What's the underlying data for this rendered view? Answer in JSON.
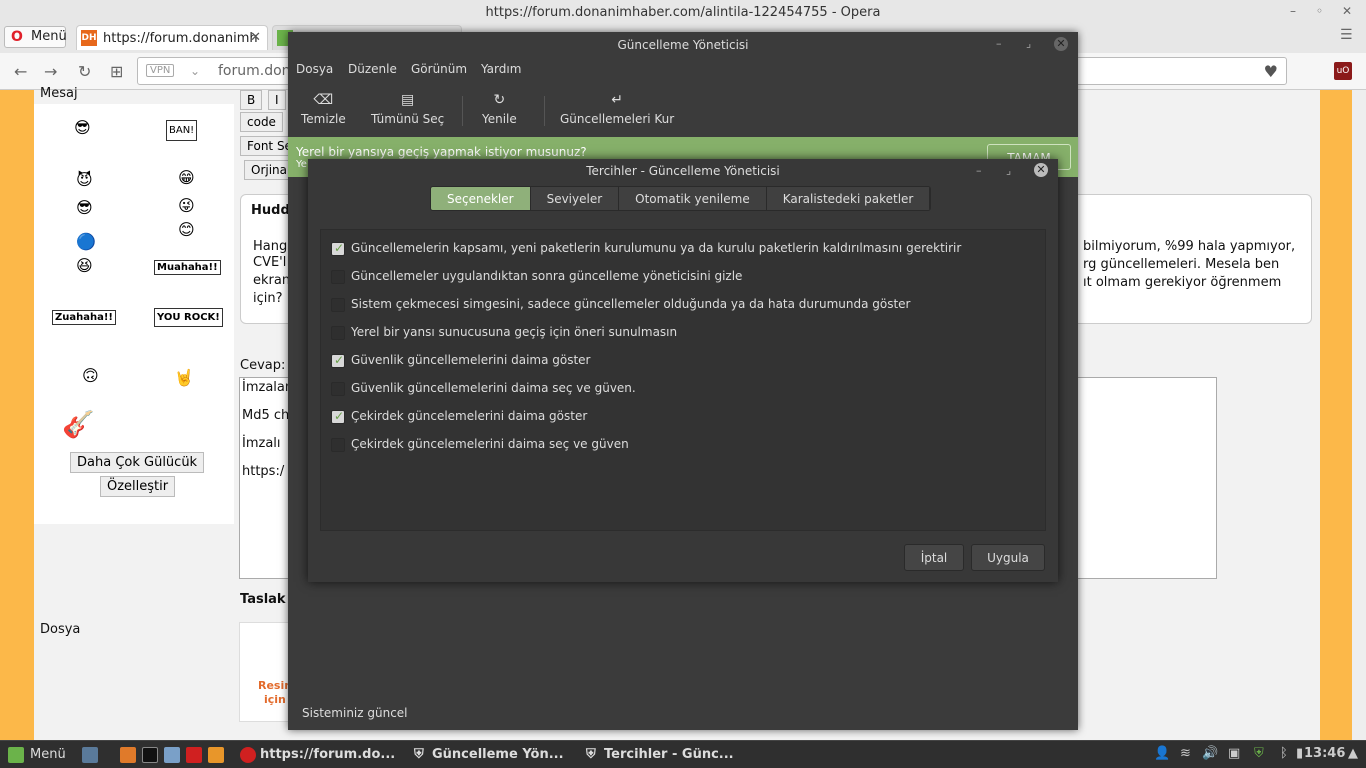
{
  "opera": {
    "window_title": "https://forum.donanimhaber.com/alintila-122454755 - Opera",
    "menu_label": "Menü",
    "tab1_label": "https://forum.donanimh",
    "tab1_icon": "DH",
    "vpn_label": "VPN",
    "url_text": "forum.dona"
  },
  "forum": {
    "mesaj_label": "Mesaj",
    "ban_sign": "BAN!",
    "muahaha_sign": "Muahaha!!",
    "zuahaha_sign": "Zuahaha!!",
    "rock_sign": "ROCK!",
    "you_sign": "YOU",
    "more_smileys": "Daha Çok Gülücük",
    "customize": "Özelleştir",
    "toolbar_bold": "B",
    "toolbar_italic": "I",
    "toolbar_code": "code",
    "font_select": "Font Se",
    "orijinal": "Orjinal",
    "quote_author": "Hudd",
    "quote_line1": "Hang",
    "quote_line2": "CVE'l",
    "quote_line3": "ekran",
    "quote_line4": "için?",
    "quote_right1": "bilmiyorum, %99 hala yapmıyor,",
    "quote_right2": "rg güncellemeleri. Mesela ben",
    "quote_right3": "ıt olmam gerekiyor öğrenmem",
    "cevap_label": "Cevap:",
    "reply_line1": "İmzalam",
    "reply_line2": "Md5 che",
    "reply_line3": "İmzalı",
    "reply_line4": "https:/",
    "taslak": "Taslak",
    "dosya_label": "Dosya",
    "upload_text1": "Resim",
    "upload_text2": "için"
  },
  "update_manager": {
    "title": "Güncelleme Yöneticisi",
    "menu": [
      "Dosya",
      "Düzenle",
      "Görünüm",
      "Yardım"
    ],
    "toolbar": {
      "clear": "Temizle",
      "select_all": "Tümünü Seç",
      "refresh": "Yenile",
      "install": "Güncellemeleri Kur"
    },
    "infobar_text": "Yerel bir yansıya geçiş yapmak istiyor musunuz?",
    "infobar_sub": "Ye",
    "infobar_button": "TAMAM",
    "status": "Sisteminiz güncel"
  },
  "preferences": {
    "title": "Tercihler - Güncelleme Yöneticisi",
    "tabs": [
      "Seçenekler",
      "Seviyeler",
      "Otomatik yenileme",
      "Karalistedeki paketler"
    ],
    "active_tab": "Seçenekler",
    "options": [
      {
        "label": "Güncellemelerin kapsamı, yeni paketlerin kurulumunu ya da kurulu paketlerin kaldırılmasını gerektirir",
        "checked": true
      },
      {
        "label": "Güncellemeler uygulandıktan sonra güncelleme yöneticisini gizle",
        "checked": false
      },
      {
        "label": "Sistem çekmecesi simgesini, sadece güncellemeler olduğunda ya da hata durumunda göster",
        "checked": false
      },
      {
        "label": "Yerel bir yansı sunucusuna geçiş için öneri sunulmasın",
        "checked": false
      },
      {
        "label": "Güvenlik güncellemelerini daima göster",
        "checked": true
      },
      {
        "label": "Güvenlik güncellemelerini daima seç ve güven.",
        "checked": false
      },
      {
        "label": "Çekirdek güncelemelerini daima göster",
        "checked": true
      },
      {
        "label": "Çekirdek güncelemelerini daima seç ve güven",
        "checked": false
      }
    ],
    "cancel": "İptal",
    "apply": "Uygula"
  },
  "taskbar": {
    "menu": "Menü",
    "task1": "https://forum.do...",
    "task2": "Güncelleme Yön...",
    "task3": "Tercihler - Günc...",
    "clock": "13:46"
  }
}
